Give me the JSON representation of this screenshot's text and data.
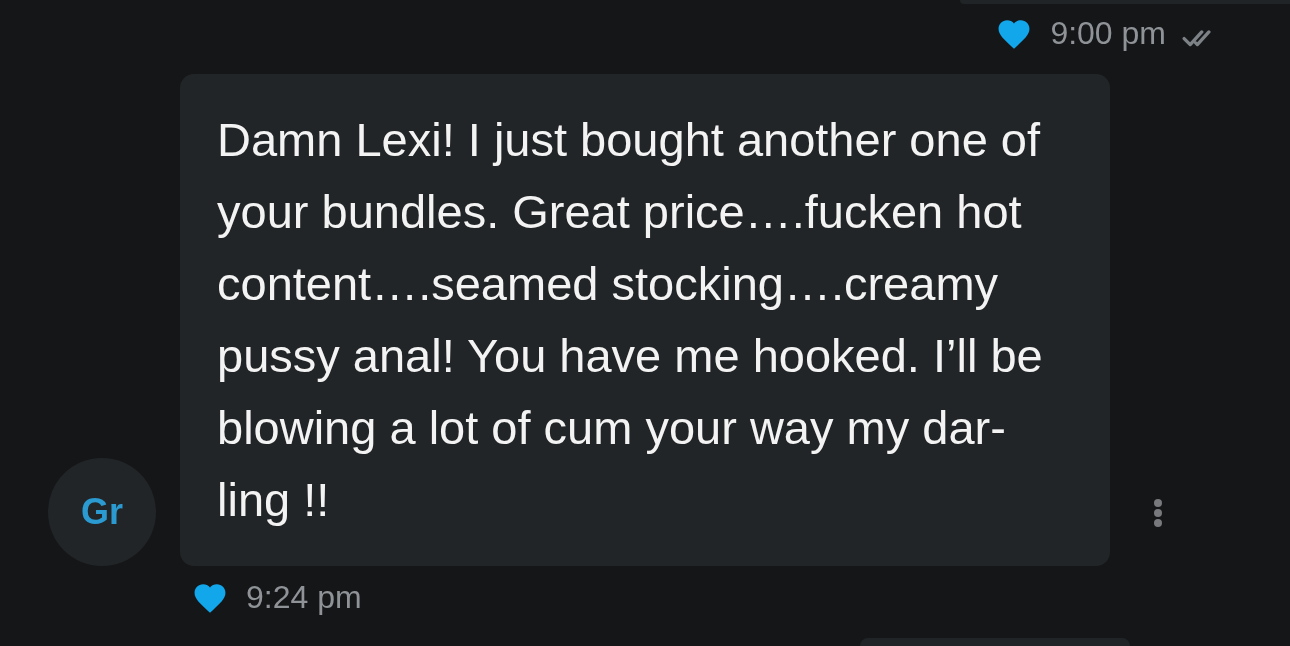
{
  "previous_message": {
    "liked": true,
    "time": "9:00 pm"
  },
  "message": {
    "avatar_initials": "Gr",
    "text": "Damn Lexi! I just bought another one of\nyour bundles. Great price….fucken hot\ncontent….seamed stocking….creamy\npussy anal! You have me hooked. I’ll be\nblowing a lot of cum your way my dar-\nling !!",
    "liked": true,
    "time": "9:24 pm"
  }
}
